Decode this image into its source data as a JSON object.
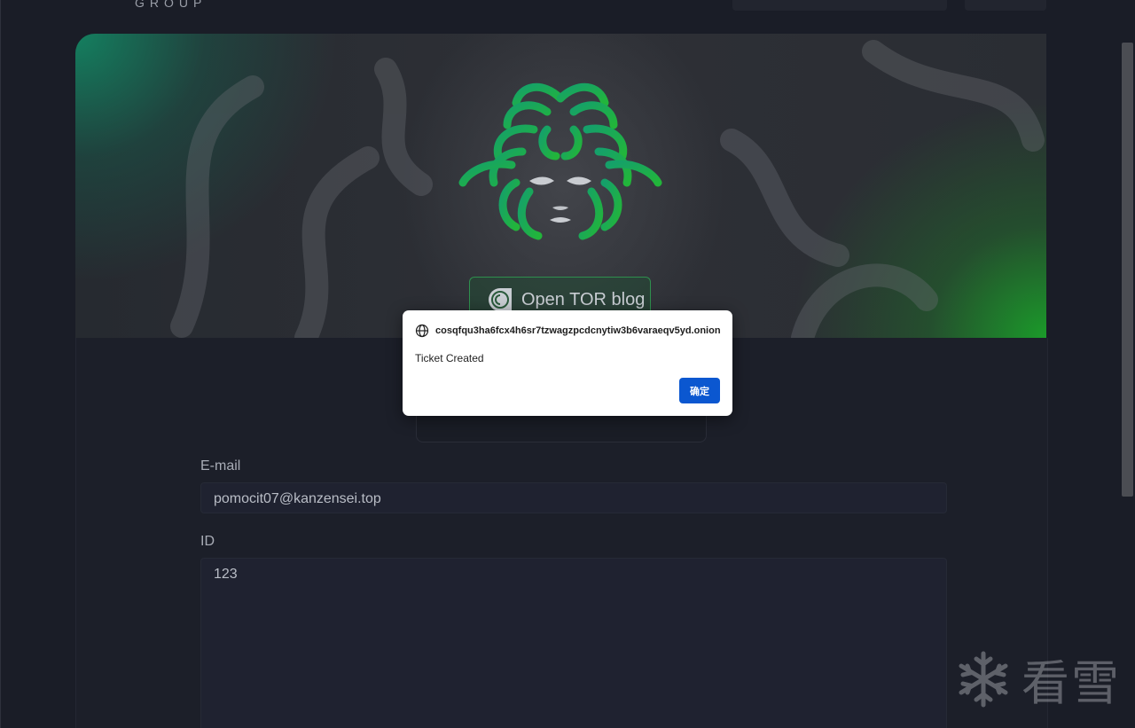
{
  "header": {
    "brand_text": "GROUP"
  },
  "hero": {
    "tor_button_label": "Open TOR blog",
    "accent_color": "#1fa84a"
  },
  "form": {
    "email_label": "E-mail",
    "email_value": "pomocit07@kanzensei.top",
    "id_label": "ID",
    "id_value": "123"
  },
  "dialog": {
    "origin_faded": "",
    "origin": "cosqfqu3ha6fcx4h6sr7tzwagzpcdcnytiw3b6varaeqv5yd.onion",
    "message": "Ticket Created",
    "ok_label": "确定",
    "button_color": "#0b57d0"
  },
  "watermark": {
    "text": "看雪"
  },
  "icons": [
    "medusa-logo-icon",
    "tor-onion-icon",
    "globe-icon",
    "snowflake-icon"
  ]
}
